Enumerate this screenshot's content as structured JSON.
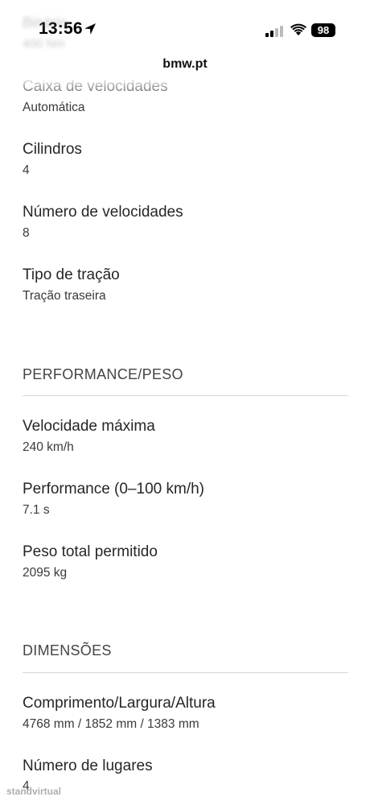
{
  "status_bar": {
    "time": "13:56",
    "battery": "98"
  },
  "browser": {
    "url": "bmw.pt"
  },
  "ghost_header": {
    "label": "Binário",
    "value": "400 Nm"
  },
  "specs": [
    {
      "label": "Caixa de velocidades",
      "value": "Automática"
    },
    {
      "label": "Cilindros",
      "value": "4"
    },
    {
      "label": "Número de velocidades",
      "value": "8"
    },
    {
      "label": "Tipo de tração",
      "value": "Tração traseira"
    }
  ],
  "performance_section": {
    "title": "PERFORMANCE/PESO",
    "items": [
      {
        "label": "Velocidade máxima",
        "value": "240 km/h"
      },
      {
        "label": "Performance (0–100 km/h)",
        "value": "7.1 s"
      },
      {
        "label": "Peso total permitido",
        "value": "2095 kg"
      }
    ]
  },
  "dimensions_section": {
    "title": "DIMENSÕES",
    "items": [
      {
        "label": "Comprimento/Largura/Altura",
        "value": "4768 mm / 1852 mm / 1383 mm"
      },
      {
        "label": "Número de lugares",
        "value": "4"
      }
    ]
  },
  "watermark": "standvirtual",
  "icons": {
    "location": "location-arrow-icon",
    "signal": "cellular-signal-icon",
    "wifi": "wifi-icon"
  }
}
